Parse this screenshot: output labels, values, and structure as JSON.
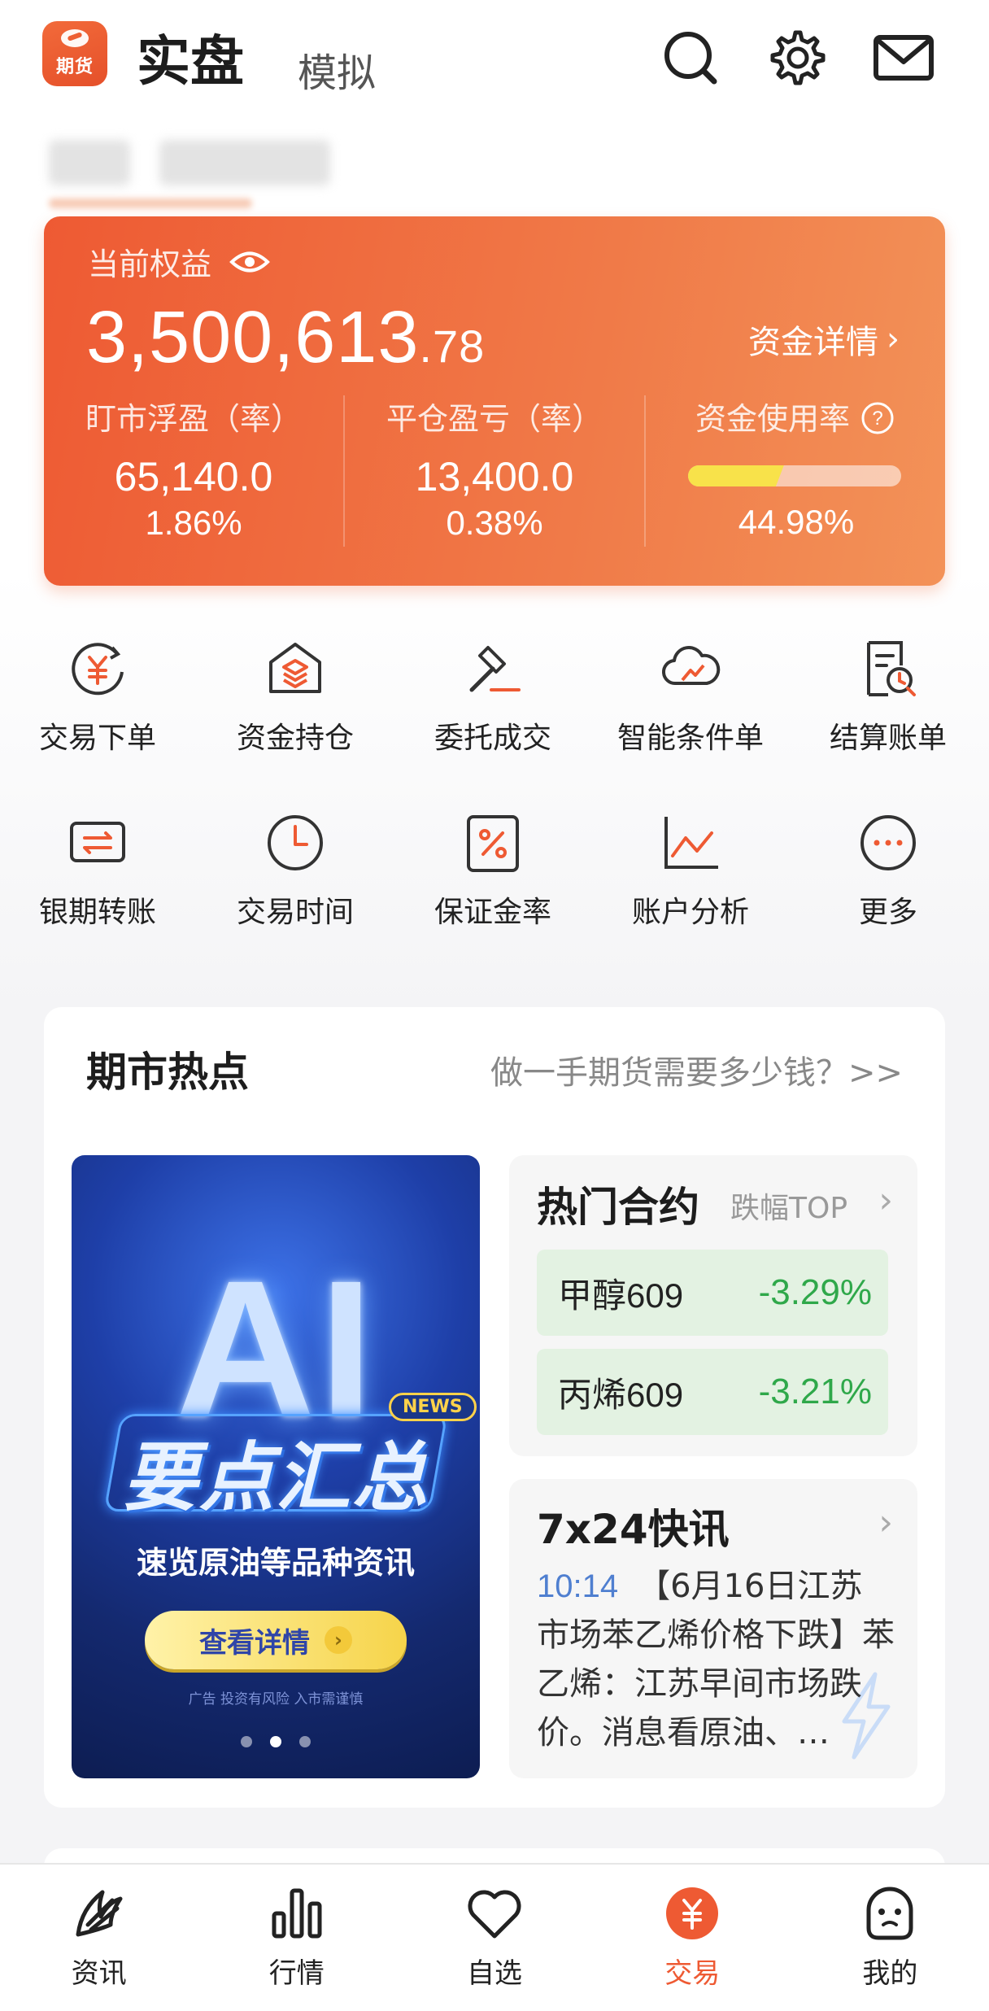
{
  "header": {
    "logo_text": "期货",
    "tab_real": "实盘",
    "tab_sim": "模拟"
  },
  "equity": {
    "label": "当前权益",
    "value_int": "3,500,613",
    "value_dec": ".78",
    "details_link": "资金详情",
    "metrics": [
      {
        "title": "盯市浮盈（率）",
        "value": "65,140.0",
        "rate": "1.86%"
      },
      {
        "title": "平仓盈亏（率）",
        "value": "13,400.0",
        "rate": "0.38%"
      }
    ],
    "usage": {
      "title": "资金使用率",
      "value": "44.98%",
      "fraction": 0.4498
    }
  },
  "shortcuts": [
    {
      "label": "交易下单",
      "icon": "yuan-refresh-icon"
    },
    {
      "label": "资金持仓",
      "icon": "layers-house-icon"
    },
    {
      "label": "委托成交",
      "icon": "gavel-icon"
    },
    {
      "label": "智能条件单",
      "icon": "cloud-chart-icon"
    },
    {
      "label": "结算账单",
      "icon": "bill-search-icon"
    },
    {
      "label": "银期转账",
      "icon": "card-transfer-icon"
    },
    {
      "label": "交易时间",
      "icon": "clock-icon"
    },
    {
      "label": "保证金率",
      "icon": "percent-icon"
    },
    {
      "label": "账户分析",
      "icon": "line-chart-icon"
    },
    {
      "label": "更多",
      "icon": "more-icon"
    }
  ],
  "hotspot": {
    "title": "期市热点",
    "link": "做一手期货需要多少钱？>>",
    "banner": {
      "big_text": "AI",
      "badge": "NEWS",
      "heading": "要点汇总",
      "subtitle": "速览原油等品种资讯",
      "button": "查看详情",
      "risk_note": "广告 投资有风险 入市需谨慎"
    },
    "hot_contracts": {
      "title": "热门合约",
      "subtitle": "跌幅TOP",
      "items": [
        {
          "name": "甲醇609",
          "change": "-3.29%"
        },
        {
          "name": "丙烯609",
          "change": "-3.21%"
        }
      ]
    },
    "flash": {
      "title": "7x24快讯",
      "time": "10:14",
      "text": "【6月16日江苏市场苯乙烯价格下跌】苯乙烯：江苏早间市场跌价。消息看原油、…"
    }
  },
  "bottom_nav": [
    {
      "label": "资讯",
      "icon": "news-icon"
    },
    {
      "label": "行情",
      "icon": "bar-chart-icon"
    },
    {
      "label": "自选",
      "icon": "heart-icon"
    },
    {
      "label": "交易",
      "icon": "yuan-coin-icon",
      "active": true
    },
    {
      "label": "我的",
      "icon": "face-icon"
    }
  ],
  "colors": {
    "accent": "#ee5a33",
    "down": "#2fa84a",
    "usage_fill": "#f8e24a"
  }
}
